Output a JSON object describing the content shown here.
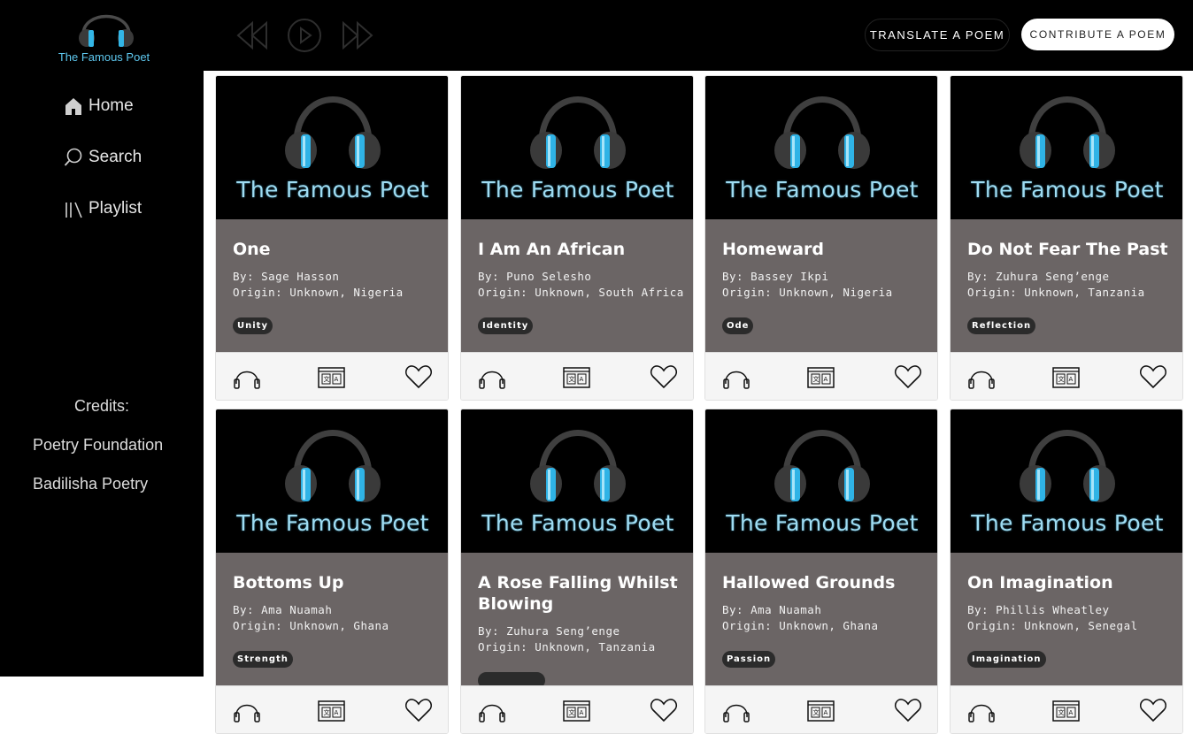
{
  "app": {
    "logo_text": "The Famous Poet"
  },
  "sidebar": {
    "items": [
      {
        "label": "Home",
        "icon": "home-icon"
      },
      {
        "label": "Search",
        "icon": "search-icon"
      },
      {
        "label": "Playlist",
        "icon": "playlist-icon"
      }
    ],
    "credits_label": "Credits:",
    "credits": [
      "Poetry Foundation",
      "Badilisha Poetry"
    ]
  },
  "player": {
    "controls": [
      "rewind-icon",
      "play-icon",
      "fast-forward-icon"
    ]
  },
  "header": {
    "translate_label": "TRANSLATE A POEM",
    "contribute_label": "CONTRIBUTE A POEM"
  },
  "colors": {
    "sidebar_bg": "#000000",
    "card_info_bg": "#6b6565",
    "accent_blue": "#5ec8ef"
  },
  "poems": [
    {
      "cover_text": "The Famous Poet",
      "title": "One",
      "by": "By: Sage Hasson",
      "origin": "Origin: Unknown, Nigeria",
      "tag": "Unity"
    },
    {
      "cover_text": "The Famous Poet",
      "title": "I Am An African",
      "by": "By: Puno Selesho",
      "origin": "Origin: Unknown, South Africa",
      "tag": "Identity"
    },
    {
      "cover_text": "The Famous Poet",
      "title": "Homeward",
      "by": "By: Bassey Ikpi",
      "origin": "Origin: Unknown, Nigeria",
      "tag": "Ode"
    },
    {
      "cover_text": "The Famous Poet",
      "title": "Do Not Fear The Past",
      "by": "By: Zuhura Seng’enge",
      "origin": "Origin: Unknown, Tanzania",
      "tag": "Reflection"
    },
    {
      "cover_text": "The Famous Poet",
      "title": "Bottoms Up",
      "by": "By: Ama Nuamah",
      "origin": "Origin: Unknown, Ghana",
      "tag": "Strength"
    },
    {
      "cover_text": "The Famous Poet",
      "title": "A Rose Falling Whilst Blowing",
      "by": "By: Zuhura Seng’enge",
      "origin": "Origin: Unknown, Tanzania",
      "tag": ""
    },
    {
      "cover_text": "The Famous Poet",
      "title": "Hallowed Grounds",
      "by": "By: Ama Nuamah",
      "origin": "Origin: Unknown, Ghana",
      "tag": "Passion"
    },
    {
      "cover_text": "The Famous Poet",
      "title": "On Imagination",
      "by": "By: Phillis Wheatley",
      "origin": "Origin: Unknown, Senegal",
      "tag": "Imagination"
    }
  ]
}
